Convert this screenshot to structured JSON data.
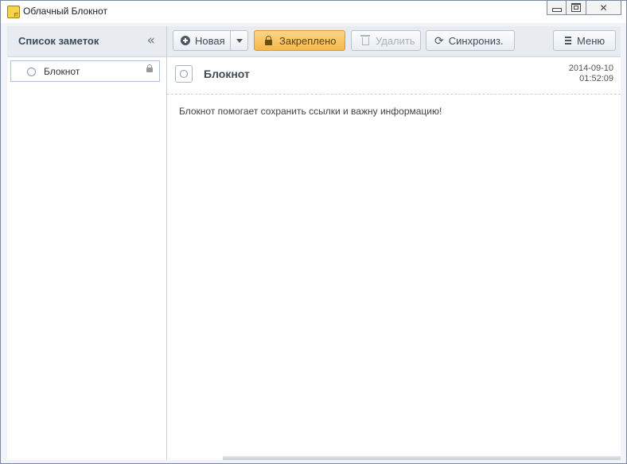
{
  "window": {
    "title": "Облачный Блокнот"
  },
  "sidebar": {
    "title": "Список заметок",
    "collapse_icon": "double-chevron-left-icon",
    "items": [
      {
        "label": "Блокнот",
        "locked": true
      }
    ]
  },
  "toolbar": {
    "new_label": "Новая",
    "pin_label": "Закреплено",
    "delete_label": "Удалить",
    "sync_label": "Синхрониз.",
    "menu_label": "Меню"
  },
  "note": {
    "title": "Блокнот",
    "date": "2014-09-10",
    "time": "01:52:09",
    "body": "Блокнот помогает сохранить ссылки и важну информацию!"
  },
  "colors": {
    "accent": "#f4b84a",
    "sidebar_header": "#e8ecf1"
  }
}
